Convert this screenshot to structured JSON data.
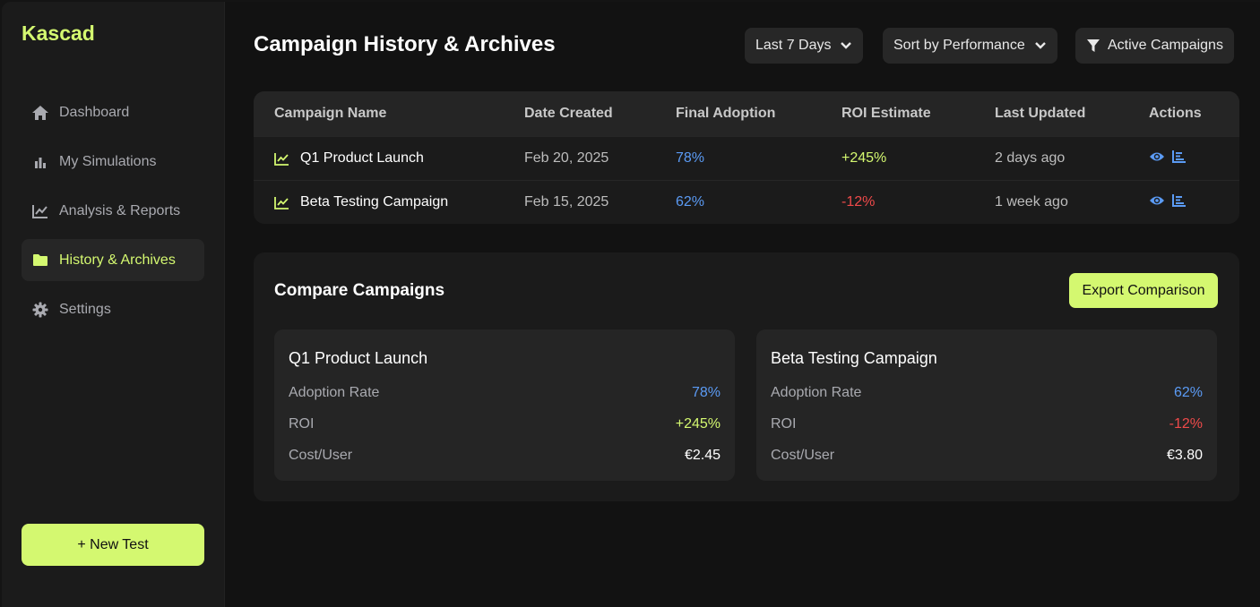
{
  "brand": "Kascad",
  "sidebar": {
    "items": [
      {
        "label": "Dashboard",
        "icon": "home-icon"
      },
      {
        "label": "My Simulations",
        "icon": "bar-chart-icon"
      },
      {
        "label": "Analysis & Reports",
        "icon": "line-chart-icon"
      },
      {
        "label": "History & Archives",
        "icon": "folder-icon",
        "active": true
      },
      {
        "label": "Settings",
        "icon": "gear-icon"
      }
    ],
    "new_test_label": "+ New Test"
  },
  "header": {
    "title": "Campaign History & Archives",
    "filters": {
      "date_range": "Last 7 Days",
      "sort": "Sort by Performance",
      "status": "Active Campaigns"
    }
  },
  "table": {
    "columns": [
      "Campaign Name",
      "Date Created",
      "Final Adoption",
      "ROI Estimate",
      "Last Updated",
      "Actions"
    ],
    "rows": [
      {
        "name": "Q1 Product Launch",
        "date": "Feb 20, 2025",
        "adoption": "78%",
        "roi": "+245%",
        "updated": "2 days ago"
      },
      {
        "name": "Beta Testing Campaign",
        "date": "Feb 15, 2025",
        "adoption": "62%",
        "roi": "-12%",
        "updated": "1 week ago"
      }
    ]
  },
  "compare": {
    "title": "Compare Campaigns",
    "export_label": "Export Comparison",
    "campaigns": [
      {
        "name": "Q1 Product Launch",
        "metrics": [
          {
            "label": "Adoption Rate",
            "value": "78%"
          },
          {
            "label": "ROI",
            "value": "+245%"
          },
          {
            "label": "Cost/User",
            "value": "€2.45"
          }
        ]
      },
      {
        "name": "Beta Testing Campaign",
        "metrics": [
          {
            "label": "Adoption Rate",
            "value": "62%"
          },
          {
            "label": "ROI",
            "value": "-12%"
          },
          {
            "label": "Cost/User",
            "value": "€3.80"
          }
        ]
      }
    ]
  },
  "colors": {
    "accent": "#d4f870",
    "positive_blue": "#5b9bf5",
    "negative_red": "#ef4a4a",
    "background": "#121212",
    "surface": "#1b1b1b"
  }
}
